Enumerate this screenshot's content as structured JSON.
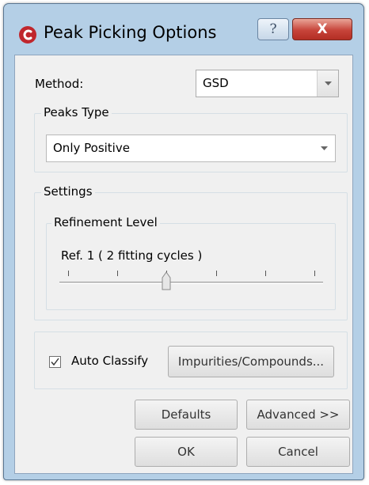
{
  "window": {
    "title": "Peak Picking Options",
    "help_glyph": "?",
    "close_glyph": "X"
  },
  "method": {
    "label": "Method:",
    "value": "GSD"
  },
  "peaks_type": {
    "group_label": "Peaks Type",
    "value": "Only Positive"
  },
  "settings": {
    "group_label": "Settings",
    "refinement": {
      "group_label": "Refinement Level",
      "level_text": "Ref. 1 ( 2 fitting cycles )",
      "slider": {
        "ticks": 6,
        "position_index": 2
      }
    }
  },
  "classify": {
    "checkbox_label": "Auto Classify",
    "checked": true,
    "impurities_button": "Impurities/Compounds..."
  },
  "buttons": {
    "defaults": "Defaults",
    "advanced": "Advanced >>",
    "ok": "OK",
    "cancel": "Cancel"
  },
  "colors": {
    "frame": "#b4cfe6",
    "client_bg": "#f0f0f0",
    "close_button": "#c7443a",
    "app_icon": "#c0272d"
  },
  "icons": {
    "app": "app-logo-icon",
    "help": "help-icon",
    "close": "close-icon",
    "dropdown": "chevron-down-icon",
    "check": "checkmark-icon"
  }
}
